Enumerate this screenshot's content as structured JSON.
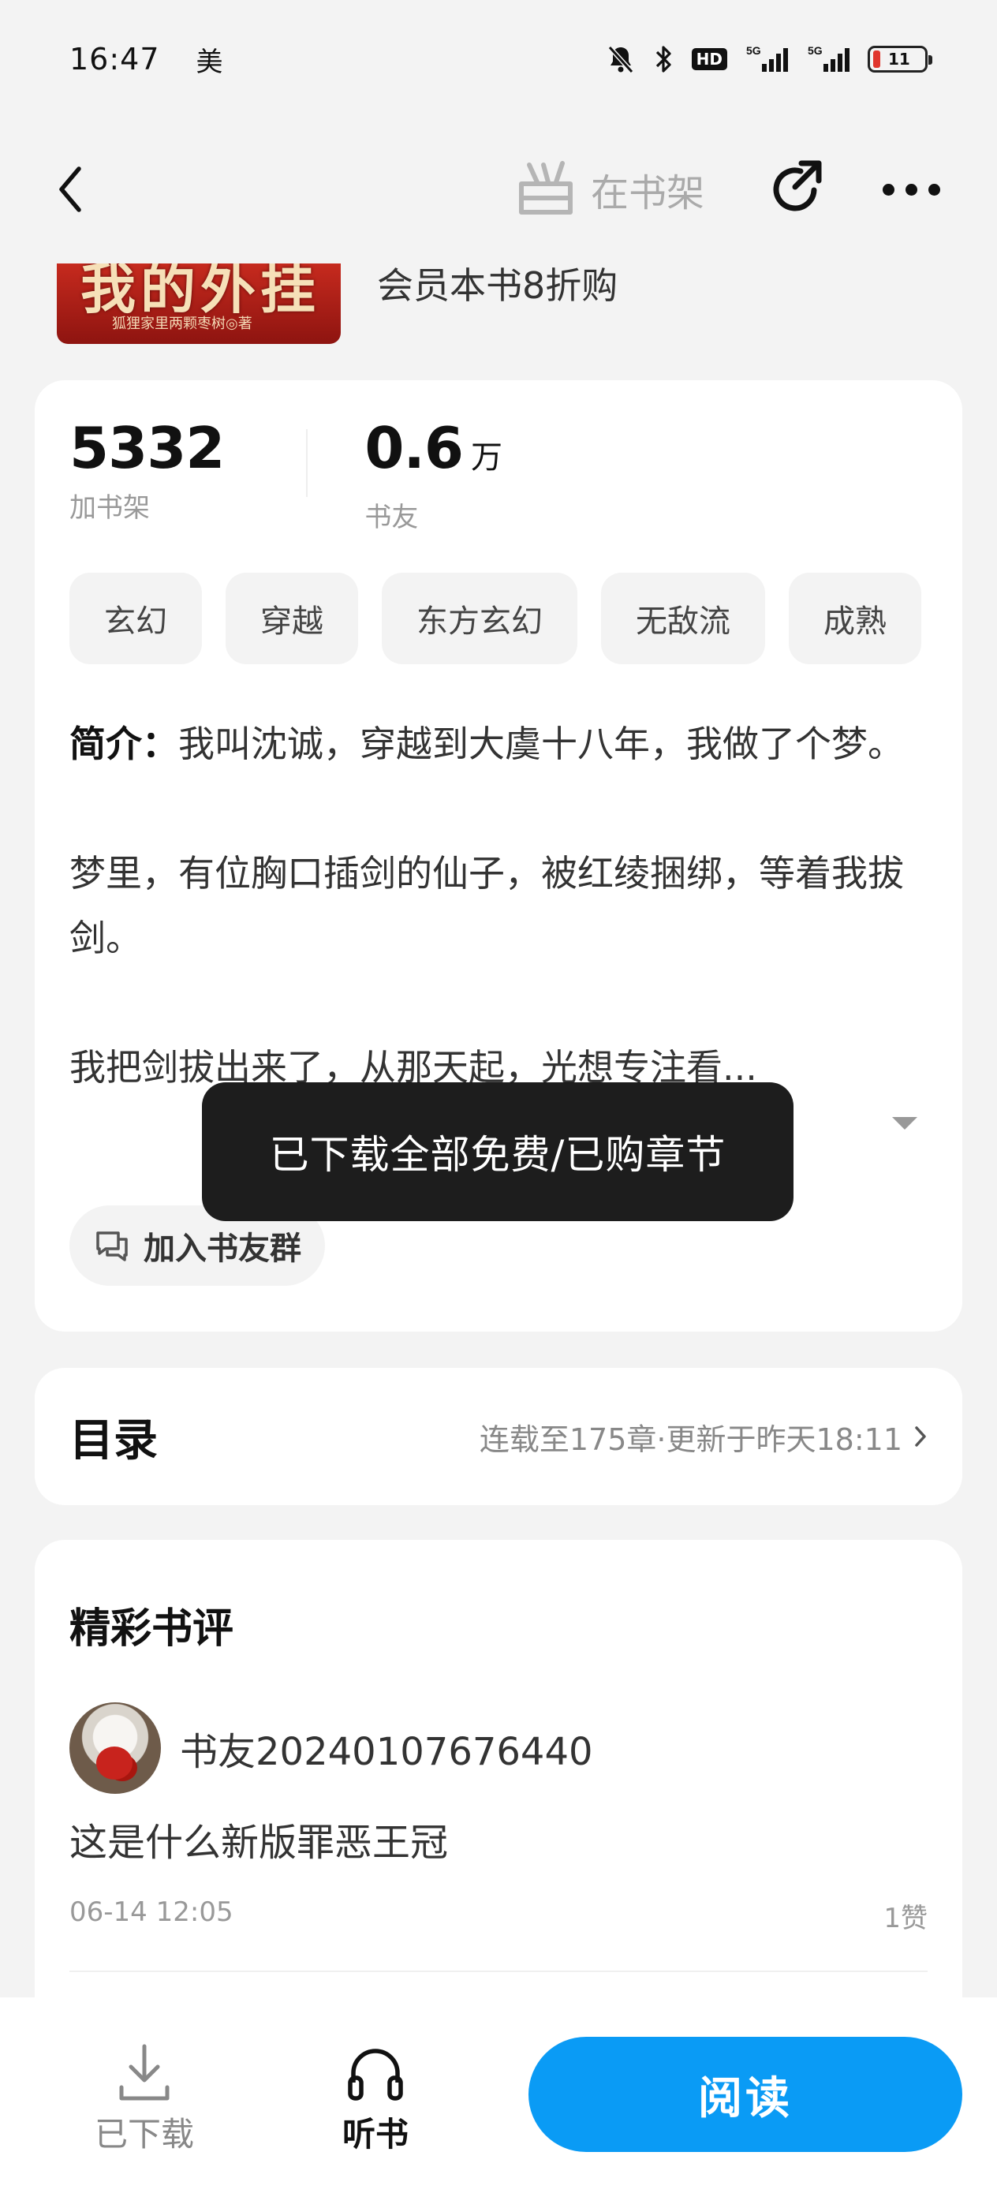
{
  "status_bar": {
    "time": "16:47",
    "carrier_icon": "美",
    "hd_badge": "HD",
    "battery_level": "11",
    "signal_1": "5G",
    "signal_2": "5G"
  },
  "nav": {
    "shelf_label": "在书架",
    "icons": [
      "back-icon",
      "bookshelf-icon",
      "share-icon",
      "more-icon"
    ]
  },
  "book": {
    "cover_title": "我的外挂",
    "cover_author": "狐狸家里两颗枣树◎著",
    "member_offer": "会员本书8折购"
  },
  "stats": [
    {
      "value": "5332",
      "unit": "",
      "label": "加书架"
    },
    {
      "value": "0.6",
      "unit": "万",
      "label": "书友"
    }
  ],
  "tags": [
    "玄幻",
    "穿越",
    "东方玄幻",
    "无敌流",
    "成熟"
  ],
  "intro": {
    "label": "简介：",
    "paragraph_1": "我叫沈诚，穿越到大虞十八年，我做了个梦。",
    "paragraph_2": "梦里，有位胸口插剑的仙子，被红绫捆绑，等着我拔剑。",
    "paragraph_3": "我把剑拔出来了，从那天起，光想专注看..."
  },
  "group_button": {
    "label": "加入书友群"
  },
  "toc": {
    "title": "目录",
    "info": "连载至175章·更新于昨天18:11"
  },
  "reviews": {
    "heading": "精彩书评",
    "items": [
      {
        "user": "书友20240107676440",
        "text": "这是什么新版罪恶王冠",
        "time": "06-14 12:05",
        "likes": "1赞"
      }
    ]
  },
  "bottom_bar": {
    "downloaded_label": "已下载",
    "listen_label": "听书",
    "read_label": "阅读"
  },
  "toast": {
    "message": "已下载全部免费/已购章节"
  },
  "colors": {
    "accent": "#0a9bf5",
    "background": "#f3f3f3",
    "toast_bg": "#141414"
  }
}
